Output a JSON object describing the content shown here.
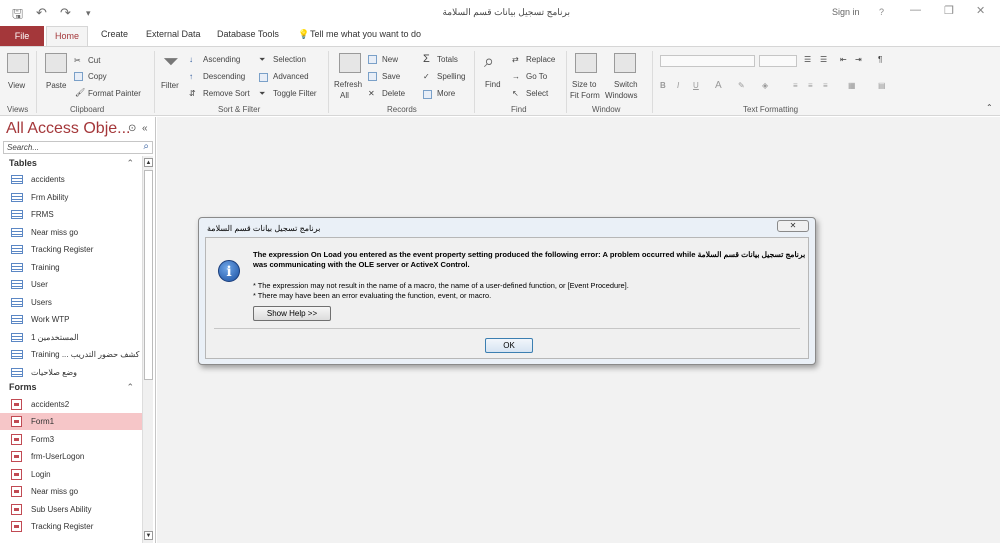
{
  "window": {
    "title": "برنامج تسجيل بيانات قسم السلامة",
    "sign_in": "Sign in",
    "help": "?",
    "minimize": "—",
    "restore": "❐",
    "close": "✕"
  },
  "quick_access": {
    "save": "🖫",
    "undo": "↶",
    "redo": "↷",
    "customize": "▾"
  },
  "tabs": {
    "file": "File",
    "home": "Home",
    "create": "Create",
    "external": "External Data",
    "dbtools": "Database Tools",
    "tellme": "Tell me what you want to do"
  },
  "ribbon": {
    "views": {
      "view": "View",
      "group": "Views"
    },
    "clipboard": {
      "paste": "Paste",
      "cut": "Cut",
      "copy": "Copy",
      "format_painter": "Format Painter",
      "group": "Clipboard"
    },
    "sort_filter": {
      "filter": "Filter",
      "ascending": "Ascending",
      "descending": "Descending",
      "remove_sort": "Remove Sort",
      "selection": "Selection",
      "advanced": "Advanced",
      "toggle_filter": "Toggle Filter",
      "group": "Sort & Filter"
    },
    "records": {
      "refresh": "Refresh",
      "refresh_all": "All",
      "new": "New",
      "save": "Save",
      "delete": "Delete",
      "totals": "Totals",
      "spelling": "Spelling",
      "more": "More",
      "group": "Records"
    },
    "find": {
      "find": "Find",
      "replace": "Replace",
      "goto": "Go To",
      "select": "Select",
      "group": "Find"
    },
    "window": {
      "size_fit": "Size to",
      "size_fit2": "Fit Form",
      "switch": "Switch",
      "switch2": "Windows",
      "group": "Window"
    },
    "text_formatting": {
      "bold": "B",
      "italic": "I",
      "underline": "U",
      "font_color": "A",
      "group": "Text Formatting"
    }
  },
  "nav": {
    "title": "All Access Obje...",
    "search_placeholder": "Search...",
    "tables_header": "Tables",
    "forms_header": "Forms",
    "tables": [
      "accidents",
      "Frm Ability",
      "FRMS",
      "Near miss go",
      "Tracking Register",
      "Training",
      "User",
      "Users",
      "Work WTP",
      "المستخدمين 1",
      "Training ... كشف حضور التدريب",
      "وضع صلاحيات"
    ],
    "forms": [
      "accidents2",
      "Form1",
      "Form3",
      "frm-UserLogon",
      "Login",
      "Near miss go",
      "Sub Users Ability",
      "Tracking Register"
    ]
  },
  "dialog": {
    "title": "برنامج تسجيل بيانات قسم السلامة",
    "close": "✕",
    "main_message": "The expression On Load you entered as the event property setting produced the following error: A problem occurred while برنامج تسجيل بيانات قسم السلامة was communicating with the OLE server or ActiveX Control.",
    "bullet1": "* The expression may not result in the name of a macro, the name of a user-defined function, or [Event Procedure].",
    "bullet2": "* There may have been an error evaluating the function, event, or macro.",
    "show_help": "Show Help >>",
    "ok": "OK"
  }
}
